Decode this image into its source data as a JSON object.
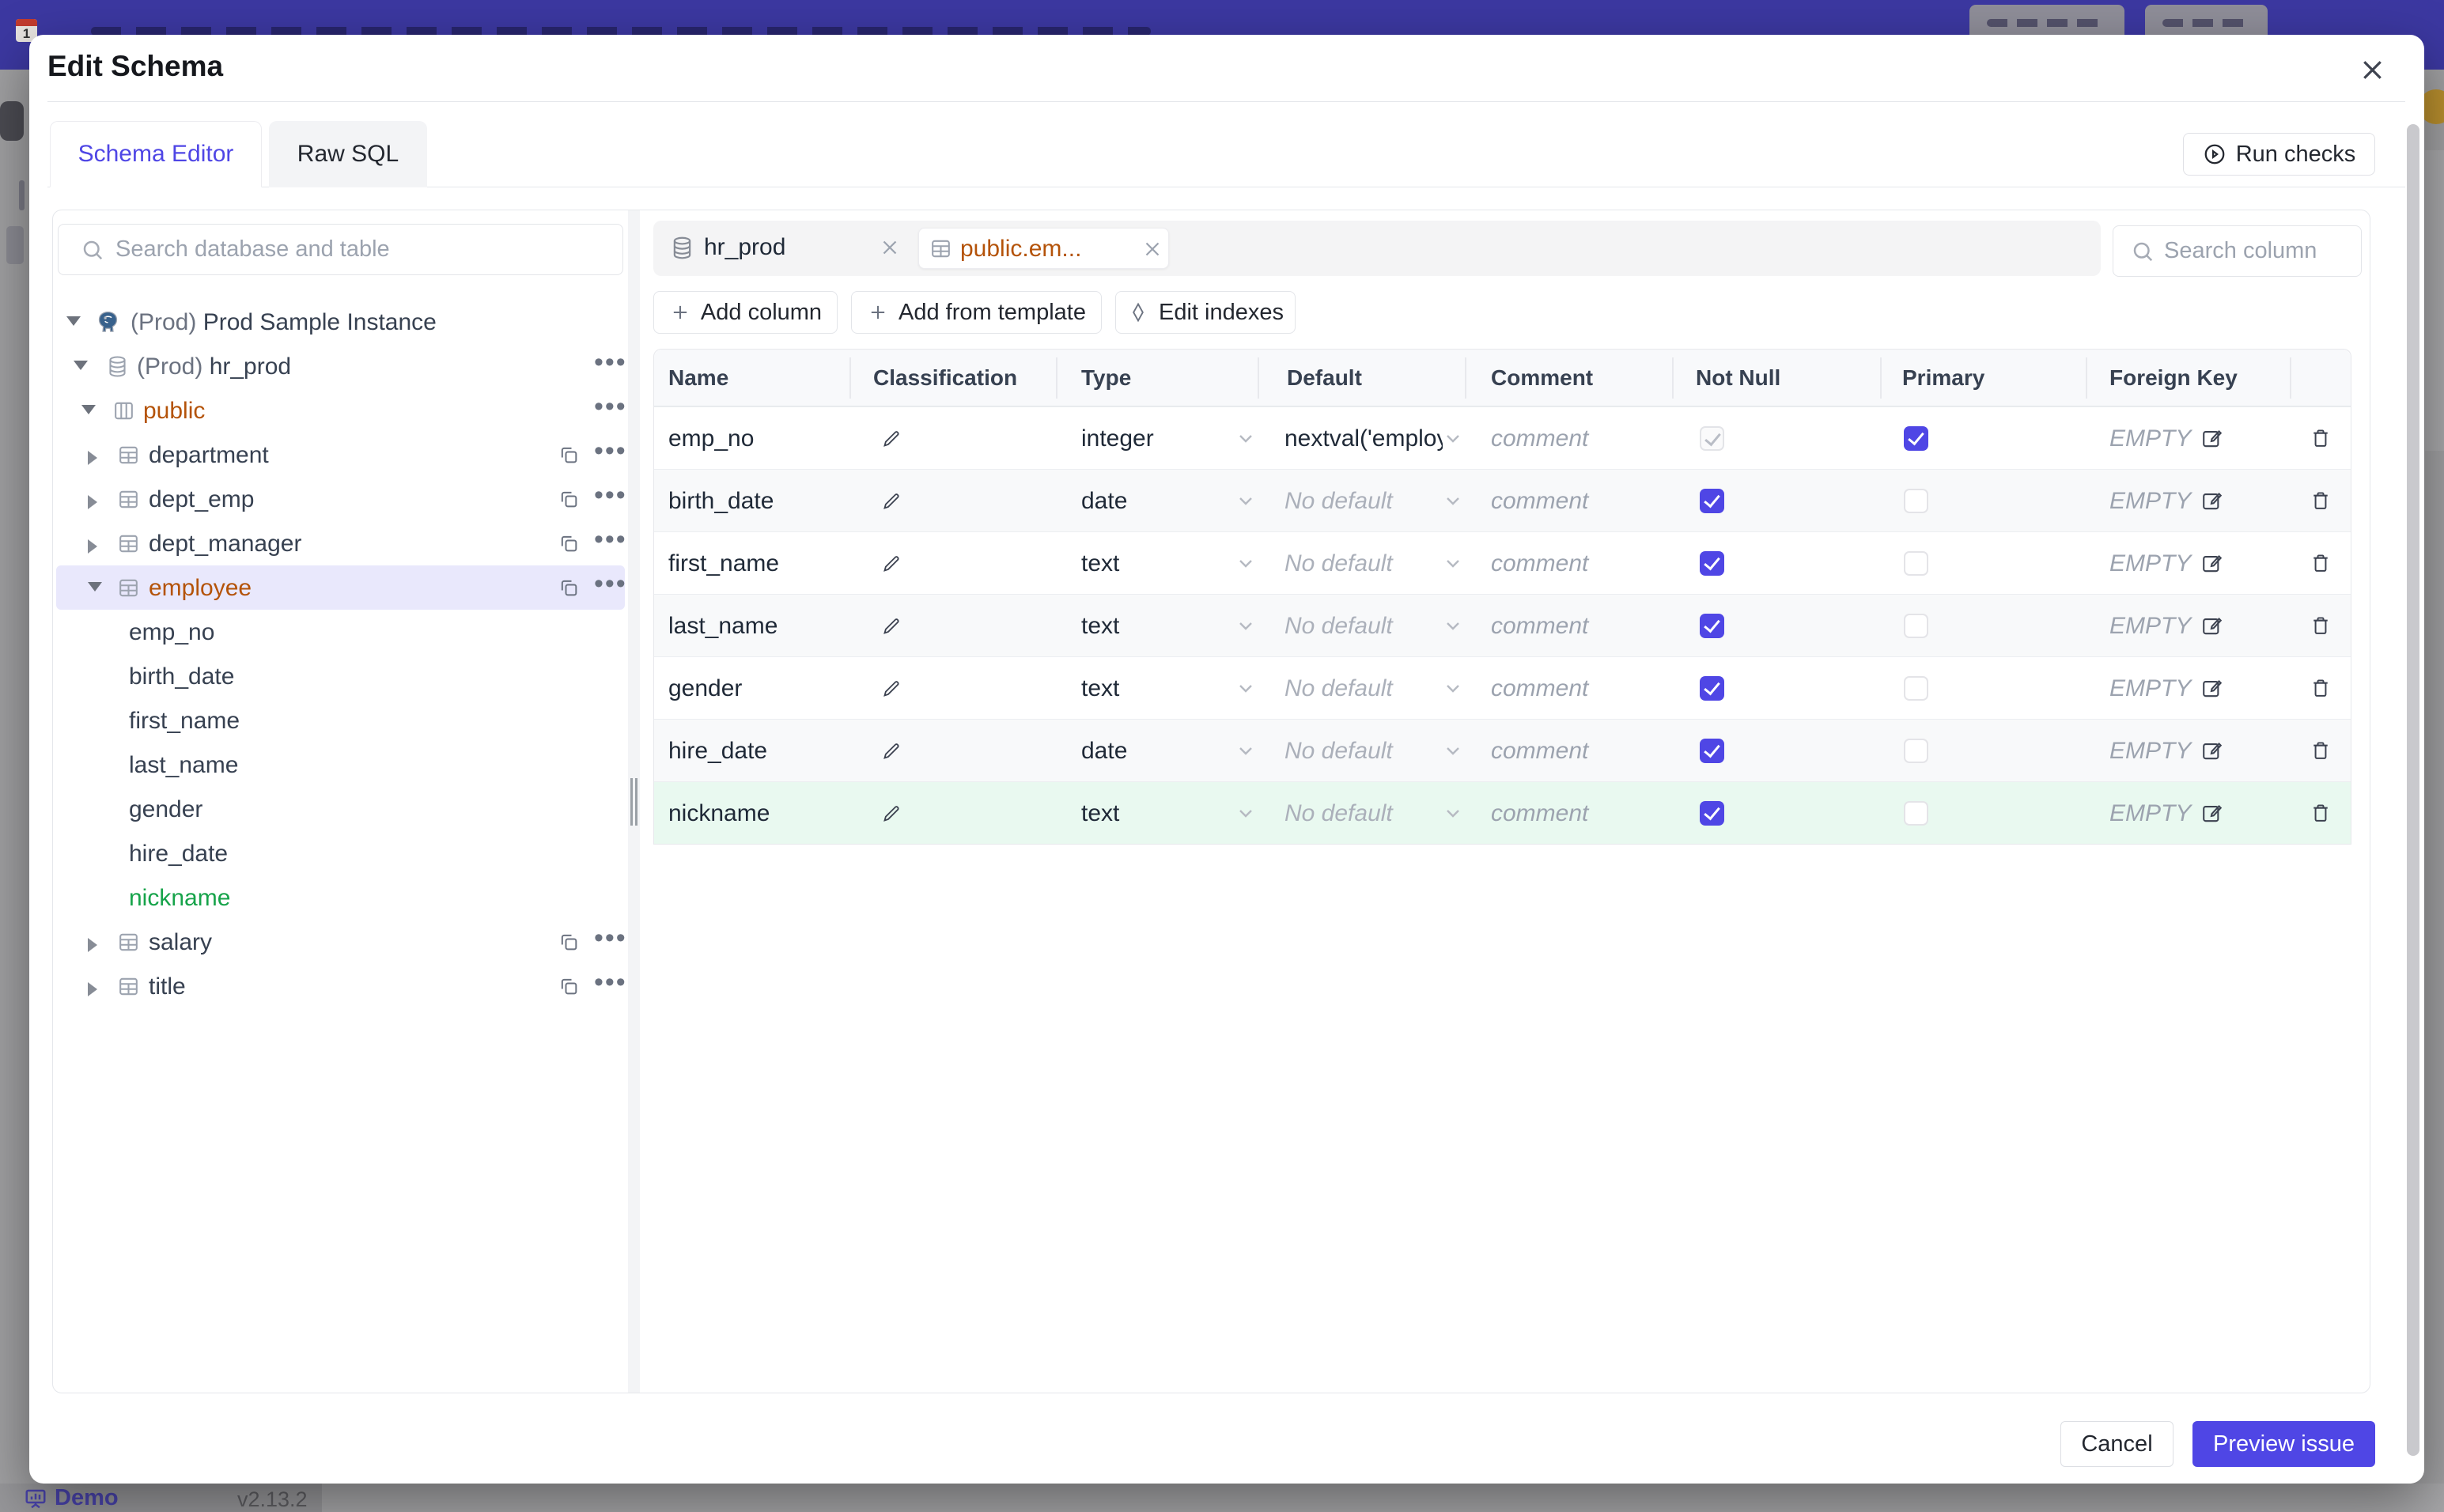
{
  "background": {
    "demo_label": "Demo",
    "version_label": "v2.13.2",
    "navbar_color": "#3c38a1"
  },
  "modal": {
    "title": "Edit Schema",
    "tabs": [
      {
        "label": "Schema Editor",
        "active": true
      },
      {
        "label": "Raw SQL",
        "active": false
      }
    ],
    "run_checks_label": "Run checks",
    "cancel_label": "Cancel",
    "preview_label": "Preview issue",
    "accent_color": "#4f46e5"
  },
  "sidebar": {
    "search_placeholder": "Search database and table",
    "tree": [
      {
        "prefix": "(Prod) ",
        "label": "Prod Sample Instance",
        "level": 0,
        "icon": "postgres-icon",
        "expanded": true
      },
      {
        "prefix": "(Prod) ",
        "label": "hr_prod",
        "level": 1,
        "icon": "database-icon",
        "expanded": true
      },
      {
        "prefix": "",
        "label": "public",
        "level": 2,
        "icon": "schema-icon",
        "expanded": true,
        "color": "amber"
      },
      {
        "prefix": "",
        "label": "department",
        "level": 3,
        "icon": "table-icon",
        "expanded": false
      },
      {
        "prefix": "",
        "label": "dept_emp",
        "level": 3,
        "icon": "table-icon",
        "expanded": false
      },
      {
        "prefix": "",
        "label": "dept_manager",
        "level": 3,
        "icon": "table-icon",
        "expanded": false
      },
      {
        "prefix": "",
        "label": "employee",
        "level": 3,
        "icon": "table-icon",
        "expanded": true,
        "color": "amber",
        "selected": true
      },
      {
        "prefix": "",
        "label": "emp_no",
        "level": 4
      },
      {
        "prefix": "",
        "label": "birth_date",
        "level": 4
      },
      {
        "prefix": "",
        "label": "first_name",
        "level": 4
      },
      {
        "prefix": "",
        "label": "last_name",
        "level": 4
      },
      {
        "prefix": "",
        "label": "gender",
        "level": 4
      },
      {
        "prefix": "",
        "label": "hire_date",
        "level": 4
      },
      {
        "prefix": "",
        "label": "nickname",
        "level": 4,
        "color": "green"
      },
      {
        "prefix": "",
        "label": "salary",
        "level": 3,
        "icon": "table-icon",
        "expanded": false
      },
      {
        "prefix": "",
        "label": "title",
        "level": 3,
        "icon": "table-icon",
        "expanded": false
      }
    ]
  },
  "editor": {
    "chips": [
      {
        "label": "hr_prod",
        "icon": "database-icon"
      },
      {
        "label": "public.em...",
        "icon": "table-icon",
        "selected": true
      }
    ],
    "column_search_placeholder": "Search column",
    "toolbar": {
      "add_column": "Add column",
      "add_from_template": "Add from template",
      "edit_indexes": "Edit indexes"
    },
    "table": {
      "headers": [
        "Name",
        "Classification",
        "Type",
        "Default",
        "Comment",
        "Not Null",
        "Primary",
        "Foreign Key"
      ],
      "comment_placeholder": "comment",
      "fk_placeholder": "EMPTY",
      "rows": [
        {
          "name": "emp_no",
          "type": "integer",
          "default": "nextval('employ",
          "has_default": true,
          "not_null": true,
          "not_null_disabled": true,
          "primary": true
        },
        {
          "name": "birth_date",
          "type": "date",
          "default": "No default",
          "has_default": false,
          "not_null": true,
          "primary": false
        },
        {
          "name": "first_name",
          "type": "text",
          "default": "No default",
          "has_default": false,
          "not_null": true,
          "primary": false
        },
        {
          "name": "last_name",
          "type": "text",
          "default": "No default",
          "has_default": false,
          "not_null": true,
          "primary": false
        },
        {
          "name": "gender",
          "type": "text",
          "default": "No default",
          "has_default": false,
          "not_null": true,
          "primary": false
        },
        {
          "name": "hire_date",
          "type": "date",
          "default": "No default",
          "has_default": false,
          "not_null": true,
          "primary": false
        },
        {
          "name": "nickname",
          "type": "text",
          "default": "No default",
          "has_default": false,
          "not_null": true,
          "primary": false,
          "highlight": "green"
        }
      ]
    }
  }
}
